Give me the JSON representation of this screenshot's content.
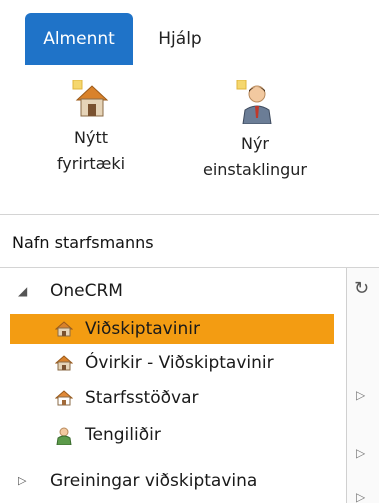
{
  "tabs": [
    {
      "label": "Almennt",
      "active": true
    },
    {
      "label": "Hjálp",
      "active": false
    }
  ],
  "ribbon": {
    "new_company": {
      "line1": "Nýtt",
      "line2": "fyrirtæki",
      "icon": "house-new-icon"
    },
    "new_person": {
      "line1": "Nýr",
      "line2": "einstaklingur",
      "icon": "person-new-icon"
    }
  },
  "section_title": "Nafn starfsmanns",
  "tree": {
    "root": {
      "label": "OneCRM",
      "expanded": true
    },
    "children": [
      {
        "label": "Viðskiptavinir",
        "selected": true,
        "icon": "house-icon"
      },
      {
        "label": "Óvirkir - Viðskiptavinir",
        "selected": false,
        "icon": "house-icon"
      },
      {
        "label": "Starfsstöðvar",
        "selected": false,
        "icon": "house-outline-icon"
      },
      {
        "label": "Tengiliðir",
        "selected": false,
        "icon": "person-icon"
      }
    ],
    "collapsed": {
      "label": "Greiningar viðskiptavina",
      "expanded": false
    }
  },
  "colors": {
    "tab_active": "#1f73c8",
    "selection": "#f39c12",
    "house_roof": "#d9822b"
  }
}
